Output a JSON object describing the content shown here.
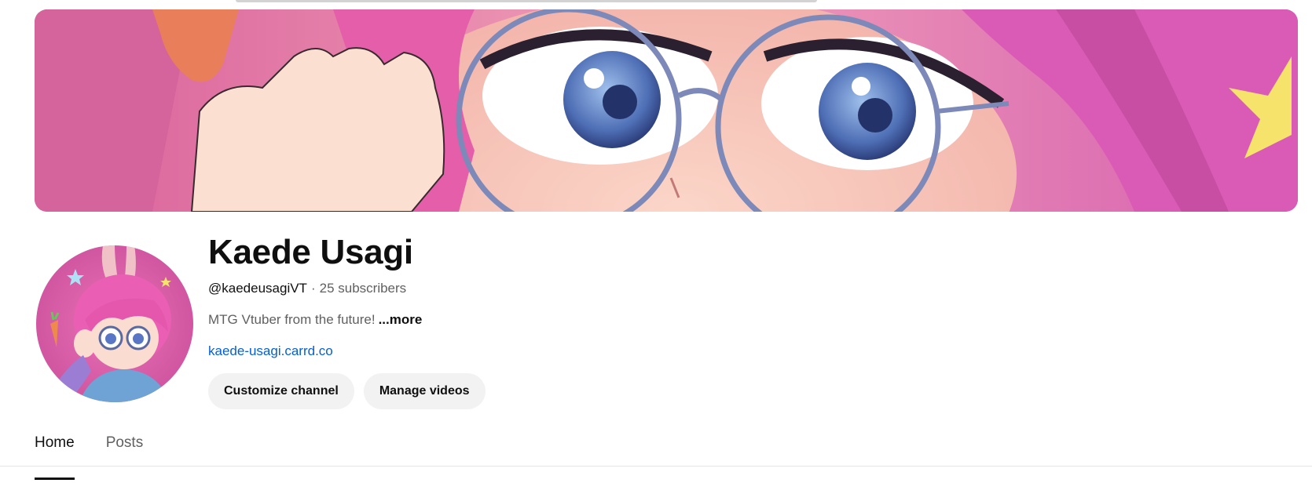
{
  "channel": {
    "name": "Kaede Usagi",
    "handle": "@kaedeusagiVT",
    "separator": "·",
    "subscribers": "25 subscribers",
    "description": "MTG Vtuber from the future!",
    "more_label": "...more",
    "link": "kaede-usagi.carrd.co"
  },
  "actions": {
    "customize_label": "Customize channel",
    "manage_label": "Manage videos"
  },
  "tabs": [
    {
      "label": "Home",
      "active": true
    },
    {
      "label": "Posts",
      "active": false
    }
  ],
  "colors": {
    "banner_pink": "#e063a8",
    "link_blue": "#065fd4",
    "button_bg": "#f2f2f2"
  }
}
